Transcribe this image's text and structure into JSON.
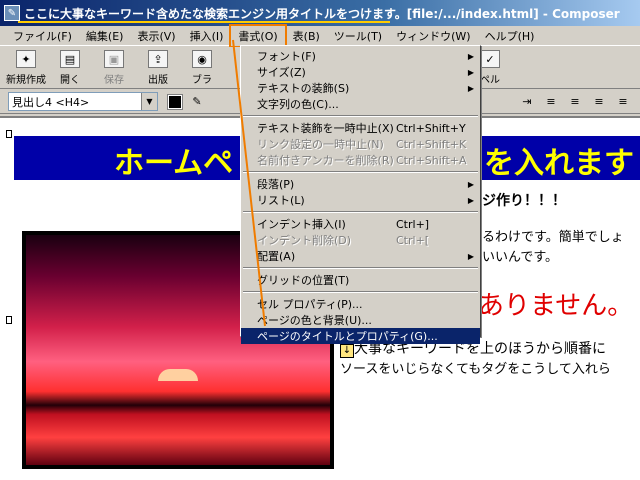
{
  "window": {
    "title": "ここに大事なキーワード含めたな検索エンジン用タイトルをつけます。[file:/.../index.html] - Composer"
  },
  "menubar": [
    {
      "name": "file",
      "label": "ファイル(F)"
    },
    {
      "name": "edit",
      "label": "編集(E)"
    },
    {
      "name": "view",
      "label": "表示(V)"
    },
    {
      "name": "insert",
      "label": "挿入(I)"
    },
    {
      "name": "format",
      "label": "書式(O)"
    },
    {
      "name": "table",
      "label": "表(B)"
    },
    {
      "name": "tools",
      "label": "ツール(T)"
    },
    {
      "name": "window",
      "label": "ウィンドウ(W)"
    },
    {
      "name": "help",
      "label": "ヘルプ(H)"
    }
  ],
  "toolbar": {
    "new": "新規作成",
    "open": "開く",
    "save": "保存",
    "publish": "出版",
    "browse": "ブラ",
    "spell": "ペル"
  },
  "formatbar": {
    "paragraph_style": "見出し4 <H4>"
  },
  "format_menu": {
    "items": [
      {
        "label": "フォント(F)",
        "shortcut": "",
        "submenu": true,
        "disabled": false
      },
      {
        "label": "サイズ(Z)",
        "shortcut": "",
        "submenu": true,
        "disabled": false
      },
      {
        "label": "テキストの装飾(S)",
        "shortcut": "",
        "submenu": true,
        "disabled": false
      },
      {
        "label": "文字列の色(C)...",
        "shortcut": "",
        "submenu": false,
        "disabled": false
      },
      {
        "sep": true
      },
      {
        "label": "テキスト装飾を一時中止(X)",
        "shortcut": "Ctrl+Shift+Y",
        "submenu": false,
        "disabled": false
      },
      {
        "label": "リンク設定の一時中止(N)",
        "shortcut": "Ctrl+Shift+K",
        "submenu": false,
        "disabled": true
      },
      {
        "label": "名前付きアンカーを削除(R)",
        "shortcut": "Ctrl+Shift+A",
        "submenu": false,
        "disabled": true
      },
      {
        "sep": true
      },
      {
        "label": "段落(P)",
        "shortcut": "",
        "submenu": true,
        "disabled": false
      },
      {
        "label": "リスト(L)",
        "shortcut": "",
        "submenu": true,
        "disabled": false
      },
      {
        "sep": true
      },
      {
        "label": "インデント挿入(I)",
        "shortcut": "Ctrl+]",
        "submenu": false,
        "disabled": false
      },
      {
        "label": "インデント削除(D)",
        "shortcut": "Ctrl+[",
        "submenu": false,
        "disabled": true
      },
      {
        "label": "配置(A)",
        "shortcut": "",
        "submenu": true,
        "disabled": false
      },
      {
        "sep": true
      },
      {
        "label": "グリッドの位置(T)",
        "shortcut": "",
        "submenu": false,
        "disabled": false
      },
      {
        "sep": true
      },
      {
        "label": "セル プロパティ(P)...",
        "shortcut": "",
        "submenu": false,
        "disabled": false
      },
      {
        "label": "ページの色と背景(U)...",
        "shortcut": "",
        "submenu": false,
        "disabled": false
      },
      {
        "label": "ページのタイトルとプロパティ(G)...",
        "shortcut": "",
        "submenu": false,
        "disabled": false,
        "highlighted": true
      }
    ]
  },
  "page": {
    "banner_left": "ホームペ",
    "banner_right": "を入れます",
    "line1": "ジ作り！！！",
    "line2": "るわけです。簡単でしょ",
    "line3": "いいんです。",
    "red_text": "ありません。",
    "line4": "大事なキーワードを上のほうから順番に",
    "line5": "ソースをいじらなくてもタグをこうして入れら"
  },
  "colors": {
    "highlight": "#0a246a",
    "banner_bg": "#0000a8",
    "banner_text": "#ffff00",
    "red_text": "#e00000",
    "annotation": "#f07c00"
  }
}
